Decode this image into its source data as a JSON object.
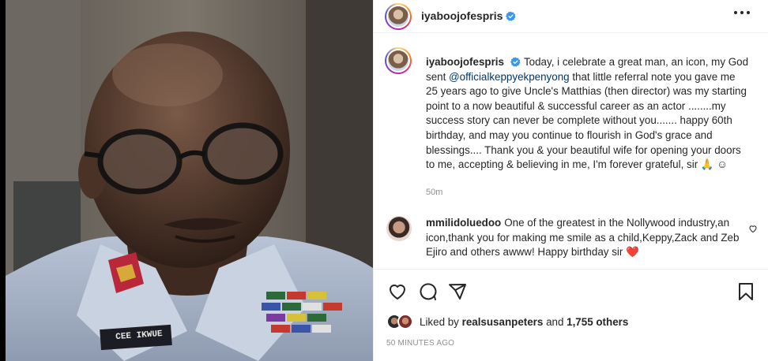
{
  "header": {
    "username": "iyaboojofespris"
  },
  "caption": {
    "username": "iyaboojofespris",
    "text_before_mention": "Today, i celebrate a great man, an icon, my God sent ",
    "mention": "@officialkeppyekpenyong",
    "text_after_mention": " that little referral note you gave me 25 years ago to give Uncle's Matthias (then director) was my starting point to a now beautiful & successful career as an actor ........my success story can never be complete without you....... happy 60th birthday, and may you continue to flourish in God's grace and blessings.... Thank you & your beautiful wife for opening your doors to me, accepting & believing in me, I'm forever grateful, sir 🙏 ☺",
    "time": "50m"
  },
  "comment": {
    "username": "mmilidoluedoo",
    "text": "One of the greatest in the Nollywood industry,an icon,thank you for making me smile as a child,Keppy,Zack and Zeb Ejiro and others awww! Happy birthday sir ❤️"
  },
  "photo": {
    "name_tag": "CEE IKWUE"
  },
  "likes": {
    "prefix": "Liked by",
    "user": "realsusanpeters",
    "middle": "and",
    "count": "1,755 others"
  },
  "posted_time": "50 MINUTES AGO",
  "icons": {
    "verified": "verified-badge-icon",
    "more": "more-options-icon",
    "like": "heart-icon",
    "comment": "comment-icon",
    "share": "share-icon",
    "save": "bookmark-icon"
  },
  "colors": {
    "verified": "#3897f0",
    "mention": "#00376b",
    "muted": "#8e8e8e",
    "text": "#262626"
  }
}
